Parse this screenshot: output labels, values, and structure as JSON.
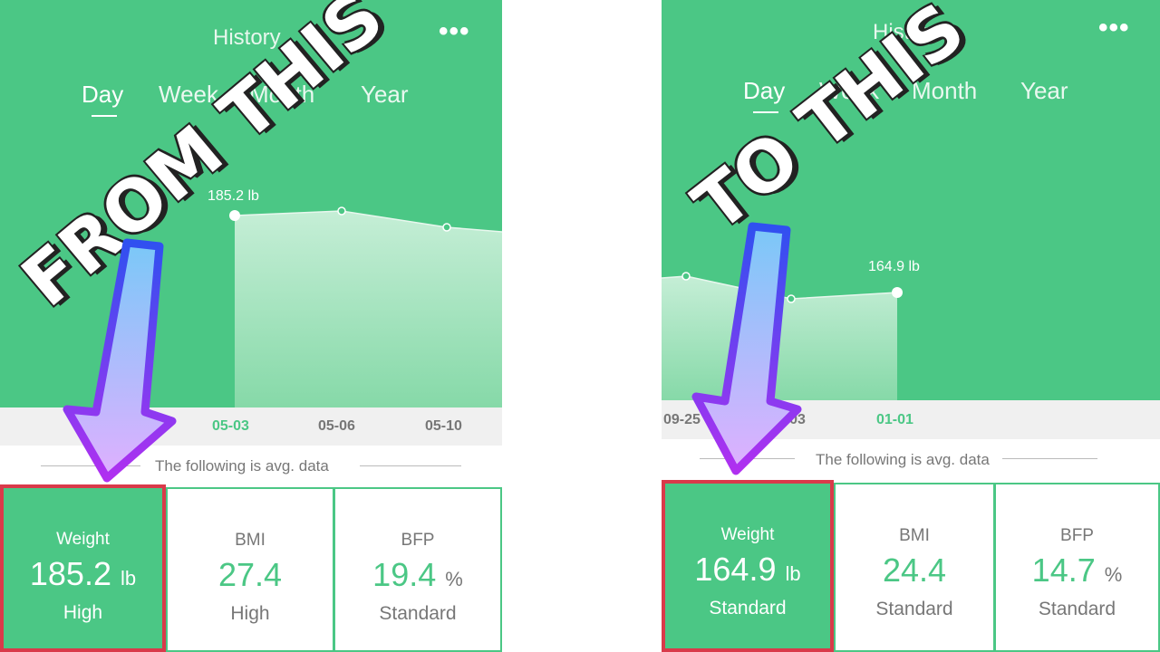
{
  "before": {
    "title": "History",
    "menu_icon": "more-dots-icon",
    "tabs": [
      "Day",
      "Week",
      "Month",
      "Year"
    ],
    "active_tab": "Day",
    "point_label": "185.2 lb",
    "dates": [
      "05-03",
      "05-06",
      "05-10"
    ],
    "selected_date": "05-03",
    "avg_text": "The following is avg. data",
    "cards": [
      {
        "label": "Weight",
        "value": "185.2",
        "unit": "lb",
        "status": "High"
      },
      {
        "label": "BMI",
        "value": "27.4",
        "unit": "",
        "status": "High"
      },
      {
        "label": "BFP",
        "value": "19.4",
        "unit": "%",
        "status": "Standard"
      }
    ]
  },
  "after": {
    "title": "History",
    "menu_icon": "more-dots-icon",
    "tabs": [
      "Day",
      "Week",
      "Month",
      "Year"
    ],
    "active_tab": "Day",
    "point_label": "164.9 lb",
    "dates": [
      "09-25",
      "12-03",
      "01-01"
    ],
    "selected_date": "01-01",
    "avg_text": "The following is avg. data",
    "cards": [
      {
        "label": "Weight",
        "value": "164.9",
        "unit": "lb",
        "status": "Standard"
      },
      {
        "label": "BMI",
        "value": "24.4",
        "unit": "",
        "status": "Standard"
      },
      {
        "label": "BFP",
        "value": "14.7",
        "unit": "%",
        "status": "Standard"
      }
    ]
  },
  "overlay": {
    "from_text": "FROM THIS",
    "to_text": "TO THIS"
  },
  "colors": {
    "brand_green": "#4bc785",
    "highlight_red": "#d93a4a",
    "arrow_purple": "#a030f0"
  }
}
